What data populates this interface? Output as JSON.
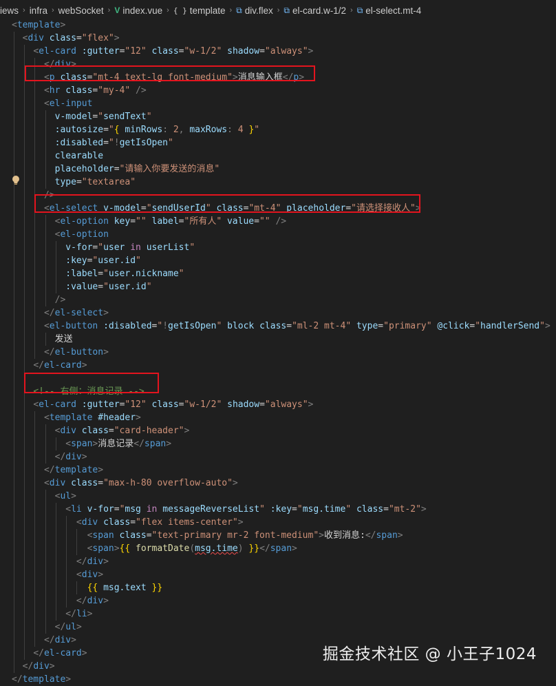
{
  "breadcrumb": [
    {
      "label": "iews",
      "icon": "none"
    },
    {
      "label": "infra",
      "icon": "none"
    },
    {
      "label": "webSocket",
      "icon": "none"
    },
    {
      "label": "index.vue",
      "icon": "vue-icon"
    },
    {
      "label": "template",
      "icon": "braces-icon"
    },
    {
      "label": "div.flex",
      "icon": "cube-icon"
    },
    {
      "label": "el-card.w-1/2",
      "icon": "cube-icon"
    },
    {
      "label": "el-select.mt-4",
      "icon": "cube-icon"
    }
  ],
  "code": {
    "line_1": "<template>",
    "line_2": "  <div class=\"flex\">",
    "line_3": "    <el-card :gutter=\"12\" class=\"w-1/2\" shadow=\"always\">",
    "line_4": "      </div>",
    "line_5": "      <p class=\"mt-4 text-lg font-medium\">消息输入框</p>",
    "line_6": "      <hr class=\"my-4\" />",
    "line_7": "      <el-input",
    "line_8": "        v-model=\"sendText\"",
    "line_9": "        :autosize=\"{ minRows: 2, maxRows: 4 }\"",
    "line_10": "        :disabled=\"!getIsOpen\"",
    "line_11": "        clearable",
    "line_12": "        placeholder=\"请输入你要发送的消息\"",
    "line_13": "        type=\"textarea\"",
    "line_14": "      />",
    "line_15": "      <el-select v-model=\"sendUserId\" class=\"mt-4\" placeholder=\"请选择接收人\">",
    "line_16": "        <el-option key=\"\" label=\"所有人\" value=\"\" />",
    "line_17": "        <el-option",
    "line_18": "          v-for=\"user in userList\"",
    "line_19": "          :key=\"user.id\"",
    "line_20": "          :label=\"user.nickname\"",
    "line_21": "          :value=\"user.id\"",
    "line_22": "        />",
    "line_23": "      </el-select>",
    "line_24": "      <el-button :disabled=\"!getIsOpen\" block class=\"ml-2 mt-4\" type=\"primary\" @click=\"handlerSend\">",
    "line_25": "        发送",
    "line_26": "      </el-button>",
    "line_27": "    </el-card>",
    "line_28": "",
    "line_29": "    <!-- 右侧：消息记录 -->",
    "line_30": "    <el-card :gutter=\"12\" class=\"w-1/2\" shadow=\"always\">",
    "line_31": "      <template #header>",
    "line_32": "        <div class=\"card-header\">",
    "line_33": "          <span>消息记录</span>",
    "line_34": "        </div>",
    "line_35": "      </template>",
    "line_36": "      <div class=\"max-h-80 overflow-auto\">",
    "line_37": "        <ul>",
    "line_38": "          <li v-for=\"msg in messageReverseList\" :key=\"msg.time\" class=\"mt-2\">",
    "line_39": "            <div class=\"flex items-center\">",
    "line_40": "              <span class=\"text-primary mr-2 font-medium\">收到消息:</span>",
    "line_41": "              <span>{{ formatDate(msg.time) }}</span>",
    "line_42": "            </div>",
    "line_43": "            <div>",
    "line_44": "              {{ msg.text }}",
    "line_45": "            </div>",
    "line_46": "          </li>",
    "line_47": "        </ul>",
    "line_48": "      </div>",
    "line_49": "    </el-card>",
    "line_50": "  </div>",
    "line_51": "</template>"
  },
  "colors": {
    "background": "#1f1f1f",
    "tag": "#569cd6",
    "bracket": "#808080",
    "attribute": "#9cdcfe",
    "string": "#ce9178",
    "keyword": "#c586c0",
    "function": "#dcdcaa",
    "brace": "#ffd700",
    "comment": "#6a9955",
    "highlight_box": "#e4141e"
  },
  "watermark": "掘金技术社区 @ 小王子1024"
}
